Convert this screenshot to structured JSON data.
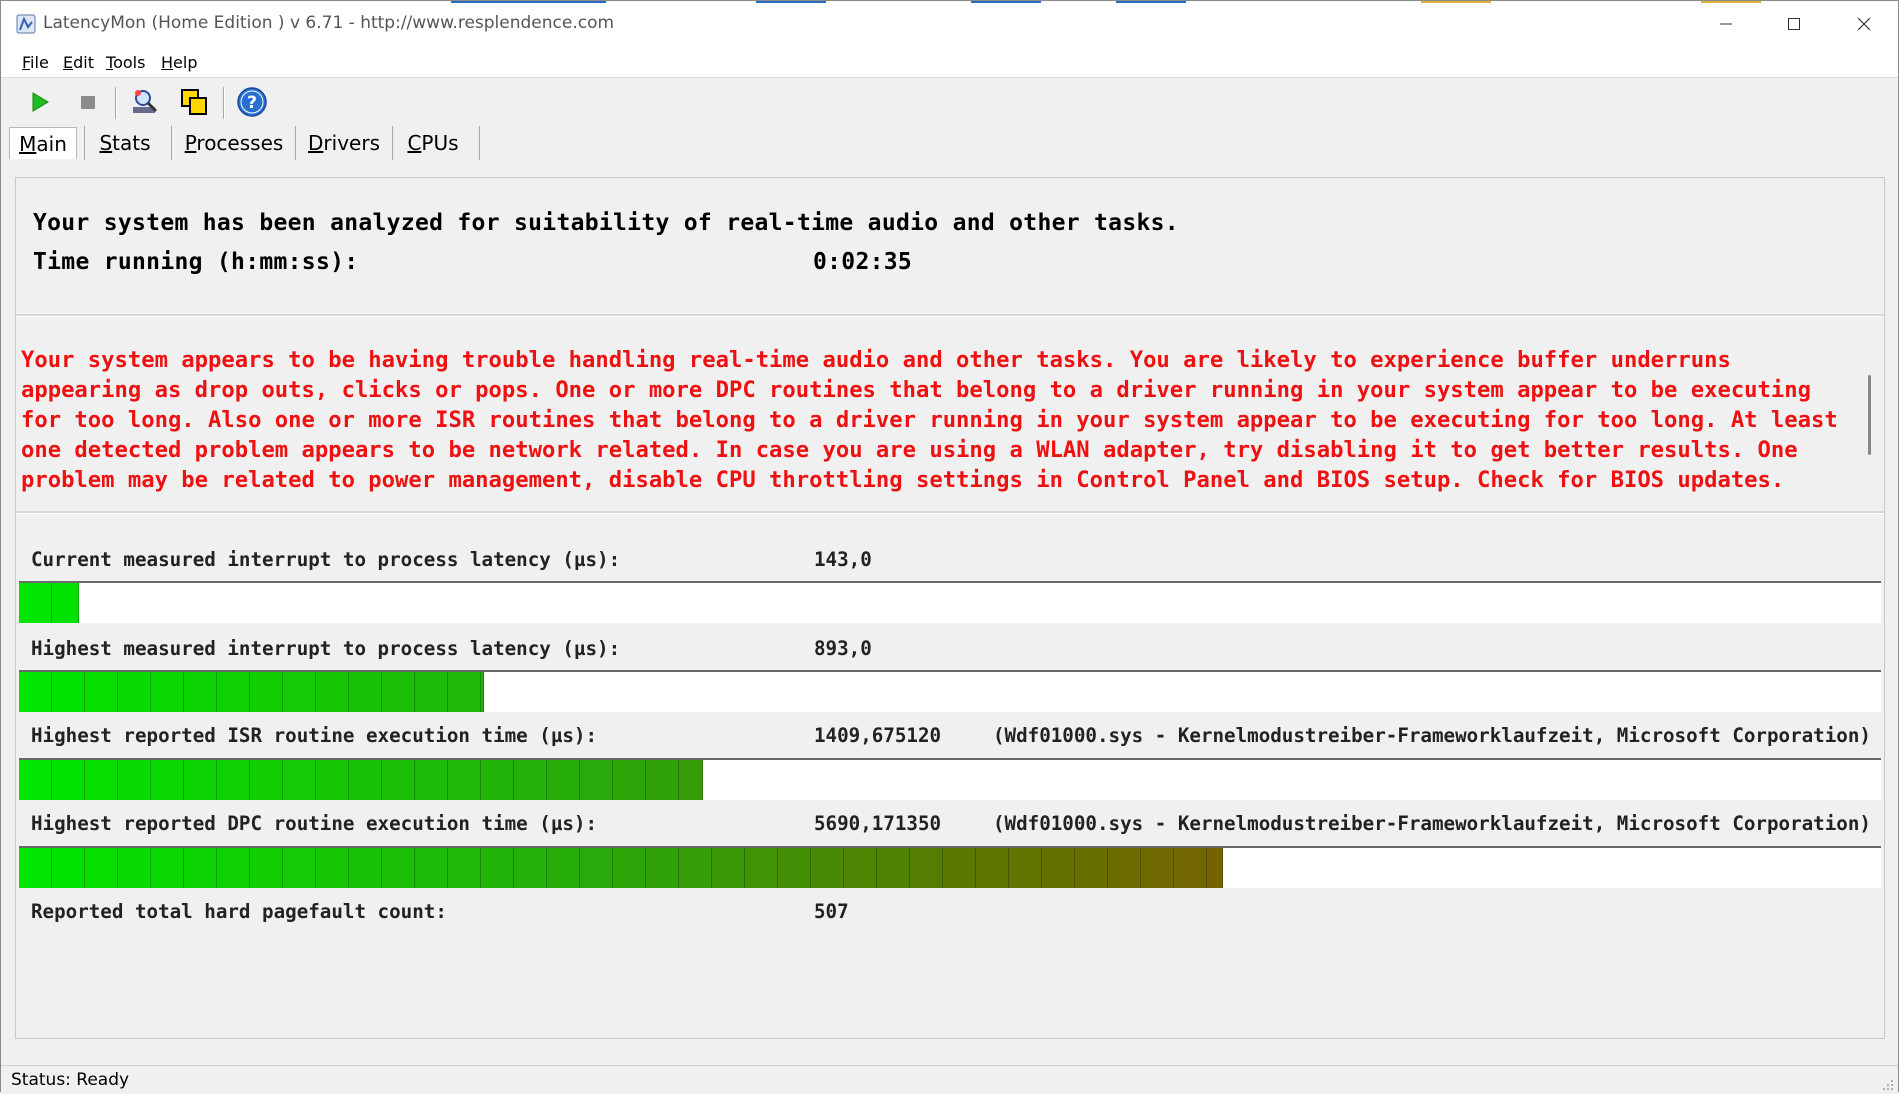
{
  "window": {
    "title": "LatencyMon  (Home Edition )  v 6.71 - http://www.resplendence.com"
  },
  "menu": [
    {
      "label": "File"
    },
    {
      "label": "Edit"
    },
    {
      "label": "Tools"
    },
    {
      "label": "Help"
    }
  ],
  "toolbar": {
    "icons": [
      "play-icon",
      "stop-icon",
      "search-icon",
      "copy-icon",
      "help-icon"
    ]
  },
  "tabs": [
    {
      "label": "Main",
      "active": true
    },
    {
      "label": "Stats",
      "active": false
    },
    {
      "label": "Processes",
      "active": false
    },
    {
      "label": "Drivers",
      "active": false
    },
    {
      "label": "CPUs",
      "active": false
    }
  ],
  "summary": {
    "headline": "Your system has been analyzed for suitability of real-time audio and other tasks.",
    "time_label": "Time running (h:mm:ss):",
    "time_value": "0:02:35"
  },
  "warning": {
    "text": "Your system appears to be having trouble handling real-time audio and other tasks. You are likely to experience buffer underruns appearing as drop outs, clicks or pops. One or more DPC routines that belong to a driver running in your system appear to be executing for too long. Also one or more ISR routines that belong to a driver running in your system appear to be executing for too long. At least one detected problem appears to be network related. In case you are using a WLAN adapter, try disabling it to get better results. One problem may be related to power management, disable CPU throttling settings in Control Panel and BIOS setup. Check for BIOS updates.",
    "color": "#ee1111"
  },
  "metrics": [
    {
      "label": "Current measured interrupt to process latency (µs):",
      "value": "143,0",
      "extra": "",
      "bar_fraction": 0.0325
    },
    {
      "label": "Highest measured interrupt to process latency (µs):",
      "value": "893,0",
      "extra": "",
      "bar_fraction": 0.25
    },
    {
      "label": "Highest reported ISR routine execution time (µs):",
      "value": "1409,675120",
      "extra": "(Wdf01000.sys - Kernelmodustreiber-Frameworklaufzeit, Microsoft Corporation)",
      "bar_fraction": 0.368
    },
    {
      "label": "Highest reported DPC routine execution time (µs):",
      "value": "5690,171350",
      "extra": "(Wdf01000.sys - Kernelmodustreiber-Frameworklaufzeit, Microsoft Corporation)",
      "bar_fraction": 0.648
    }
  ],
  "pagefault": {
    "label": "Reported total hard pagefault count:",
    "value": "507"
  },
  "status": {
    "text": "Status: Ready"
  }
}
